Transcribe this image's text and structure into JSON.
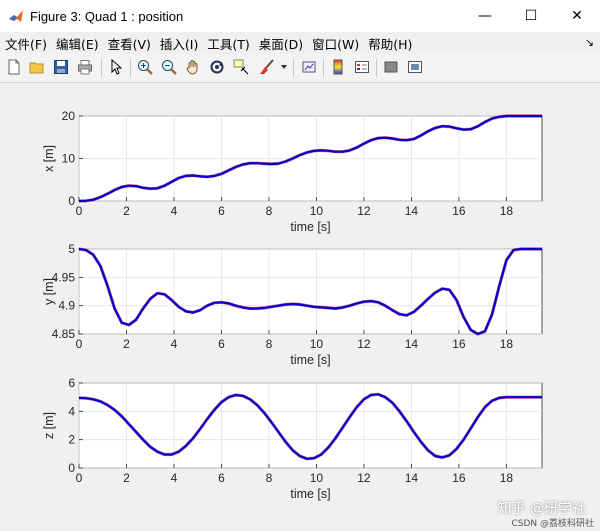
{
  "window": {
    "title": "Figure 3: Quad 1 : position",
    "minimize": "—",
    "maximize": "☐",
    "close": "✕"
  },
  "menu": {
    "items": [
      "文件(F)",
      "编辑(E)",
      "查看(V)",
      "插入(I)",
      "工具(T)",
      "桌面(D)",
      "窗口(W)",
      "帮助(H)"
    ],
    "dock_icon": "↘"
  },
  "toolbar": {
    "icons": [
      "new-figure-icon",
      "open-file-icon",
      "save-icon",
      "print-icon",
      "pointer-icon",
      "zoom-in-icon",
      "zoom-out-icon",
      "pan-icon",
      "rotate-icon",
      "data-cursor-icon",
      "brush-icon",
      "link-plot-icon",
      "colorbar-icon",
      "legend-icon",
      "hide-plot-tools-icon",
      "show-plot-tools-icon"
    ]
  },
  "colors": {
    "line_primary": "#0000cc",
    "line_secondary": "#cc0044",
    "axes_bg": "#ffffff",
    "figure_bg": "#f0f0f0"
  },
  "chart_data": [
    {
      "type": "line",
      "xlabel": "time [s]",
      "ylabel": "x [m]",
      "xlim": [
        0,
        19.5
      ],
      "ylim": [
        0,
        20
      ],
      "xticks": [
        0,
        2,
        4,
        6,
        8,
        10,
        12,
        14,
        16,
        18
      ],
      "yticks": [
        0,
        10,
        20
      ],
      "grid": true,
      "series": [
        {
          "x": [
            0,
            0.3,
            0.6,
            0.9,
            1.2,
            1.5,
            1.8,
            2.1,
            2.4,
            2.7,
            3.0,
            3.3,
            3.6,
            3.9,
            4.2,
            4.5,
            4.8,
            5.1,
            5.4,
            5.7,
            6.0,
            6.3,
            6.6,
            6.9,
            7.2,
            7.5,
            7.8,
            8.1,
            8.4,
            8.7,
            9.0,
            9.3,
            9.6,
            9.9,
            10.2,
            10.5,
            10.8,
            11.1,
            11.4,
            11.7,
            12.0,
            12.3,
            12.6,
            12.9,
            13.2,
            13.5,
            13.8,
            14.1,
            14.4,
            14.7,
            15.0,
            15.3,
            15.6,
            15.9,
            16.2,
            16.5,
            16.8,
            17.1,
            17.4,
            17.7,
            18.0,
            18.3,
            18.6,
            18.9,
            19.2,
            19.5
          ],
          "y": [
            0,
            0.05,
            0.3,
            0.9,
            1.7,
            2.6,
            3.3,
            3.6,
            3.5,
            3.1,
            2.9,
            3.0,
            3.6,
            4.5,
            5.4,
            5.9,
            6.0,
            5.8,
            5.7,
            5.9,
            6.4,
            7.2,
            8.0,
            8.6,
            8.9,
            8.9,
            8.8,
            8.7,
            8.8,
            9.3,
            10.0,
            10.8,
            11.4,
            11.8,
            11.9,
            11.8,
            11.6,
            11.6,
            11.9,
            12.6,
            13.5,
            14.3,
            14.8,
            14.9,
            14.7,
            14.4,
            14.3,
            14.6,
            15.4,
            16.4,
            17.2,
            17.6,
            17.5,
            17.1,
            16.8,
            16.9,
            17.6,
            18.6,
            19.4,
            19.8,
            20.0,
            20.0,
            20.0,
            20.0,
            20.0,
            20.0
          ]
        }
      ]
    },
    {
      "type": "line",
      "xlabel": "time [s]",
      "ylabel": "y [m]",
      "xlim": [
        0,
        19.5
      ],
      "ylim": [
        4.85,
        5
      ],
      "xticks": [
        0,
        2,
        4,
        6,
        8,
        10,
        12,
        14,
        16,
        18
      ],
      "yticks": [
        4.85,
        4.9,
        4.95,
        5
      ],
      "ytick_labels": [
        "4.85",
        "4.9",
        "4.95",
        "5"
      ],
      "grid": true,
      "series": [
        {
          "x": [
            0,
            0.3,
            0.6,
            0.9,
            1.2,
            1.5,
            1.8,
            2.1,
            2.4,
            2.7,
            3.0,
            3.3,
            3.6,
            3.9,
            4.2,
            4.5,
            4.8,
            5.1,
            5.4,
            5.7,
            6.0,
            6.3,
            6.6,
            6.9,
            7.2,
            7.5,
            7.8,
            8.1,
            8.4,
            8.7,
            9.0,
            9.3,
            9.6,
            9.9,
            10.2,
            10.5,
            10.8,
            11.1,
            11.4,
            11.7,
            12.0,
            12.3,
            12.6,
            12.9,
            13.2,
            13.5,
            13.8,
            14.1,
            14.4,
            14.7,
            15.0,
            15.3,
            15.6,
            15.9,
            16.2,
            16.5,
            16.8,
            17.1,
            17.4,
            17.7,
            18.0,
            18.3,
            18.6,
            18.9,
            19.2,
            19.5
          ],
          "y": [
            5.0,
            4.998,
            4.99,
            4.97,
            4.935,
            4.895,
            4.87,
            4.866,
            4.875,
            4.895,
            4.912,
            4.922,
            4.92,
            4.91,
            4.898,
            4.89,
            4.888,
            4.892,
            4.9,
            4.905,
            4.906,
            4.904,
            4.9,
            4.897,
            4.895,
            4.895,
            4.896,
            4.898,
            4.9,
            4.902,
            4.903,
            4.902,
            4.9,
            4.898,
            4.897,
            4.896,
            4.895,
            4.897,
            4.9,
            4.904,
            4.907,
            4.908,
            4.906,
            4.9,
            4.892,
            4.885,
            4.883,
            4.889,
            4.9,
            4.912,
            4.923,
            4.93,
            4.928,
            4.91,
            4.88,
            4.857,
            4.848,
            4.855,
            4.885,
            4.935,
            4.98,
            4.998,
            5.0,
            5.0,
            5.0,
            5.0
          ]
        }
      ]
    },
    {
      "type": "line",
      "xlabel": "time [s]",
      "ylabel": "z [m]",
      "xlim": [
        0,
        19.5
      ],
      "ylim": [
        0,
        6
      ],
      "xticks": [
        0,
        2,
        4,
        6,
        8,
        10,
        12,
        14,
        16,
        18
      ],
      "yticks": [
        0,
        2,
        4,
        6
      ],
      "grid": true,
      "series": [
        {
          "x": [
            0,
            0.3,
            0.6,
            0.9,
            1.2,
            1.5,
            1.8,
            2.1,
            2.4,
            2.7,
            3.0,
            3.3,
            3.6,
            3.9,
            4.2,
            4.5,
            4.8,
            5.1,
            5.4,
            5.7,
            6.0,
            6.3,
            6.6,
            6.9,
            7.2,
            7.5,
            7.8,
            8.1,
            8.4,
            8.7,
            9.0,
            9.3,
            9.6,
            9.9,
            10.2,
            10.5,
            10.8,
            11.1,
            11.4,
            11.7,
            12.0,
            12.3,
            12.6,
            12.9,
            13.2,
            13.5,
            13.8,
            14.1,
            14.4,
            14.7,
            15.0,
            15.3,
            15.6,
            15.9,
            16.2,
            16.5,
            16.8,
            17.1,
            17.4,
            17.7,
            18.0,
            18.3,
            18.6,
            18.9,
            19.2,
            19.5
          ],
          "y": [
            4.95,
            4.93,
            4.85,
            4.7,
            4.45,
            4.1,
            3.65,
            3.1,
            2.55,
            2.0,
            1.5,
            1.15,
            0.95,
            0.95,
            1.15,
            1.55,
            2.1,
            2.75,
            3.45,
            4.1,
            4.65,
            5.0,
            5.15,
            5.1,
            4.85,
            4.45,
            3.9,
            3.25,
            2.55,
            1.85,
            1.25,
            0.85,
            0.65,
            0.7,
            0.95,
            1.45,
            2.1,
            2.85,
            3.6,
            4.3,
            4.85,
            5.15,
            5.2,
            5.0,
            4.6,
            4.0,
            3.3,
            2.55,
            1.85,
            1.25,
            0.85,
            0.75,
            0.9,
            1.35,
            2.0,
            2.8,
            3.6,
            4.3,
            4.75,
            4.95,
            5.0,
            5.0,
            5.0,
            5.0,
            5.0,
            5.0
          ]
        }
      ]
    }
  ],
  "watermark": {
    "main": "知乎 @研学社",
    "sub": "CSDN @荔枝科研社"
  }
}
